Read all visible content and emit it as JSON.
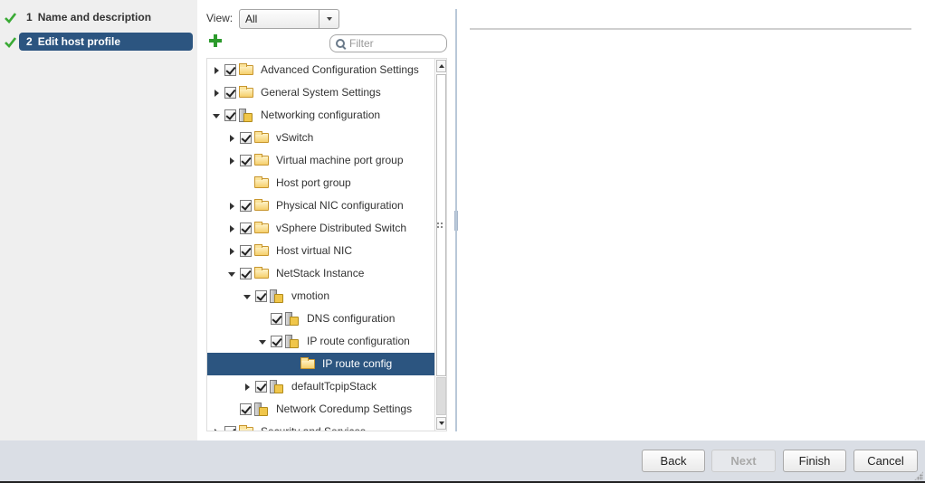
{
  "wizard": {
    "steps": [
      {
        "number": "1",
        "label": "Name and description",
        "completed": true,
        "active": false
      },
      {
        "number": "2",
        "label": "Edit host profile",
        "completed": true,
        "active": true
      }
    ]
  },
  "toolbar": {
    "view_label": "View:",
    "view_selected": "All",
    "add_icon": "plus-icon",
    "filter_placeholder": "Filter",
    "filter_value": ""
  },
  "tree": {
    "items": [
      {
        "label": "Advanced Configuration Settings",
        "depth": 0,
        "expander": "collapsed",
        "checked": true,
        "icon": "folder"
      },
      {
        "label": "General System Settings",
        "depth": 0,
        "expander": "collapsed",
        "checked": true,
        "icon": "folder"
      },
      {
        "label": "Networking configuration",
        "depth": 0,
        "expander": "expanded",
        "checked": true,
        "icon": "profile"
      },
      {
        "label": "vSwitch",
        "depth": 1,
        "expander": "collapsed",
        "checked": true,
        "icon": "folder"
      },
      {
        "label": "Virtual machine port group",
        "depth": 1,
        "expander": "collapsed",
        "checked": true,
        "icon": "folder"
      },
      {
        "label": "Host port group",
        "depth": 1,
        "expander": "none",
        "checked": null,
        "icon": "folder"
      },
      {
        "label": "Physical NIC configuration",
        "depth": 1,
        "expander": "collapsed",
        "checked": true,
        "icon": "folder"
      },
      {
        "label": "vSphere Distributed Switch",
        "depth": 1,
        "expander": "collapsed",
        "checked": true,
        "icon": "folder"
      },
      {
        "label": "Host virtual NIC",
        "depth": 1,
        "expander": "collapsed",
        "checked": true,
        "icon": "folder"
      },
      {
        "label": "NetStack Instance",
        "depth": 1,
        "expander": "expanded",
        "checked": true,
        "icon": "folder-open"
      },
      {
        "label": "vmotion",
        "depth": 2,
        "expander": "expanded",
        "checked": true,
        "icon": "profile"
      },
      {
        "label": "DNS configuration",
        "depth": 3,
        "expander": "none",
        "checked": true,
        "icon": "profile"
      },
      {
        "label": "IP route configuration",
        "depth": 3,
        "expander": "expanded",
        "checked": true,
        "icon": "profile"
      },
      {
        "label": "IP route config",
        "depth": 4,
        "expander": "none",
        "checked": null,
        "icon": "folder",
        "selected": true
      },
      {
        "label": "defaultTcpipStack",
        "depth": 2,
        "expander": "collapsed",
        "checked": true,
        "icon": "profile"
      },
      {
        "label": "Network Coredump Settings",
        "depth": 1,
        "expander": "none",
        "checked": true,
        "icon": "profile"
      },
      {
        "label": "Security and Services",
        "depth": 0,
        "expander": "collapsed",
        "checked": true,
        "icon": "folder"
      }
    ]
  },
  "footer": {
    "back_label": "Back",
    "next_label": "Next",
    "next_disabled": true,
    "finish_label": "Finish",
    "cancel_label": "Cancel"
  },
  "colors": {
    "accent": "#2c5580",
    "check_green": "#3aaa35",
    "add_green": "#2c9a2c",
    "footer_bg": "#dadee5"
  }
}
